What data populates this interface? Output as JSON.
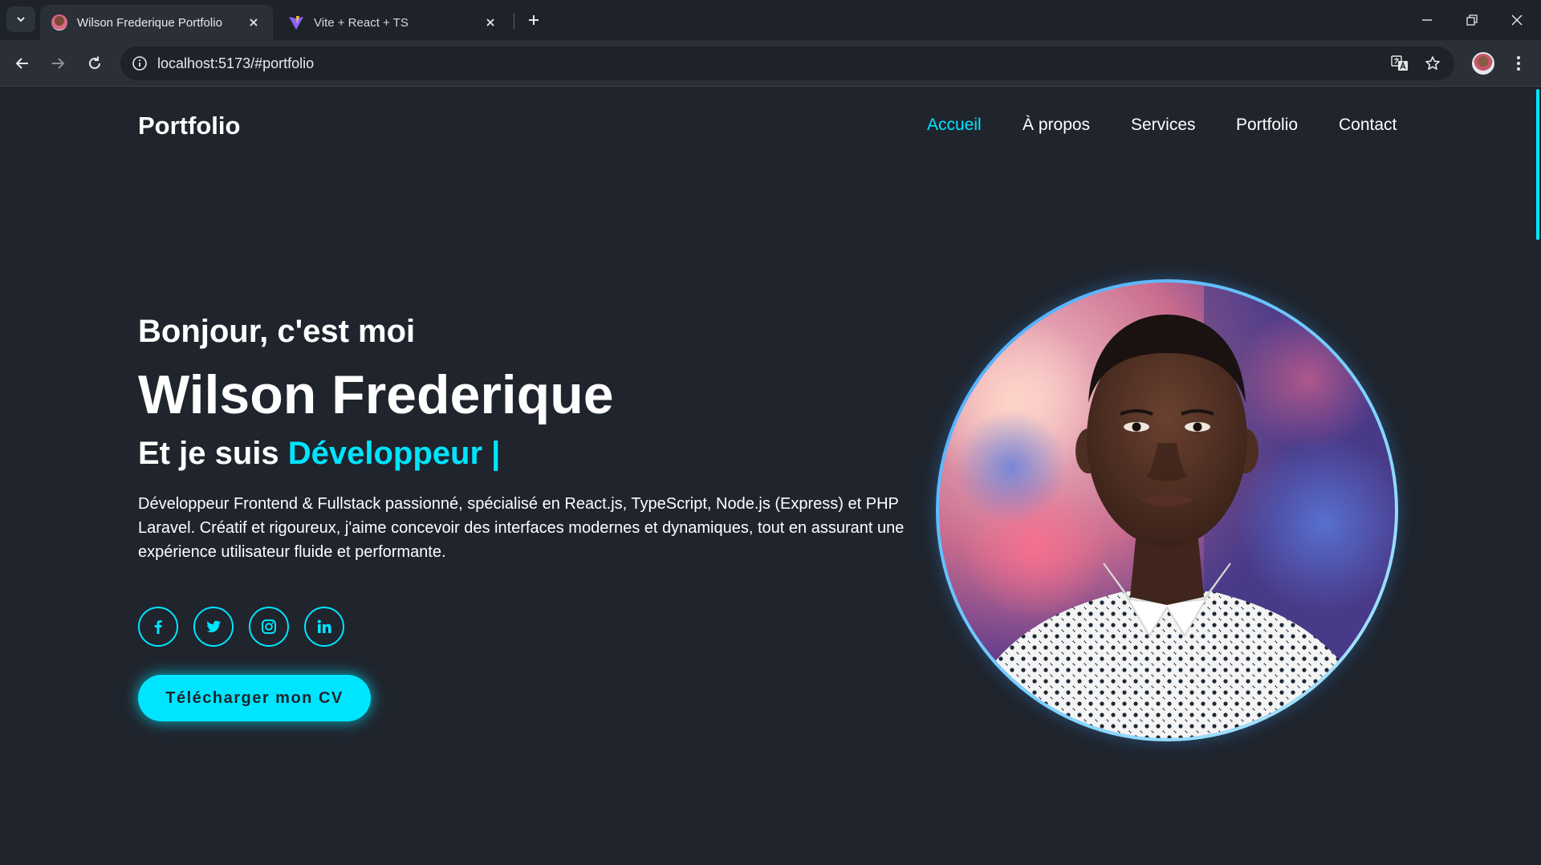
{
  "browser": {
    "tabs": [
      {
        "title": "Wilson Frederique Portfolio",
        "active": true
      },
      {
        "title": "Vite + React + TS",
        "active": false
      }
    ],
    "url": "localhost:5173/#portfolio"
  },
  "header": {
    "logo": "Portfolio",
    "nav": [
      {
        "label": "Accueil",
        "active": true
      },
      {
        "label": "À propos",
        "active": false
      },
      {
        "label": "Services",
        "active": false
      },
      {
        "label": "Portfolio",
        "active": false
      },
      {
        "label": "Contact",
        "active": false
      }
    ]
  },
  "hero": {
    "greeting": "Bonjour, c'est moi",
    "name": "Wilson Frederique",
    "role_prefix": "Et je suis",
    "role_highlight": "Développeur |",
    "bio": "Développeur Frontend & Fullstack passionné, spécialisé en React.js, TypeScript, Node.js (Express) et PHP Laravel. Créatif et rigoureux, j'aime concevoir des interfaces modernes et dynamiques, tout en assurant une expérience utilisateur fluide et performante.",
    "social": [
      "facebook-icon",
      "twitter-icon",
      "instagram-icon",
      "linkedin-icon"
    ],
    "cv_button": "Télécharger mon CV"
  },
  "colors": {
    "accent": "#00e5ff",
    "background": "#1f242d",
    "ring": "#4aa8ff"
  }
}
